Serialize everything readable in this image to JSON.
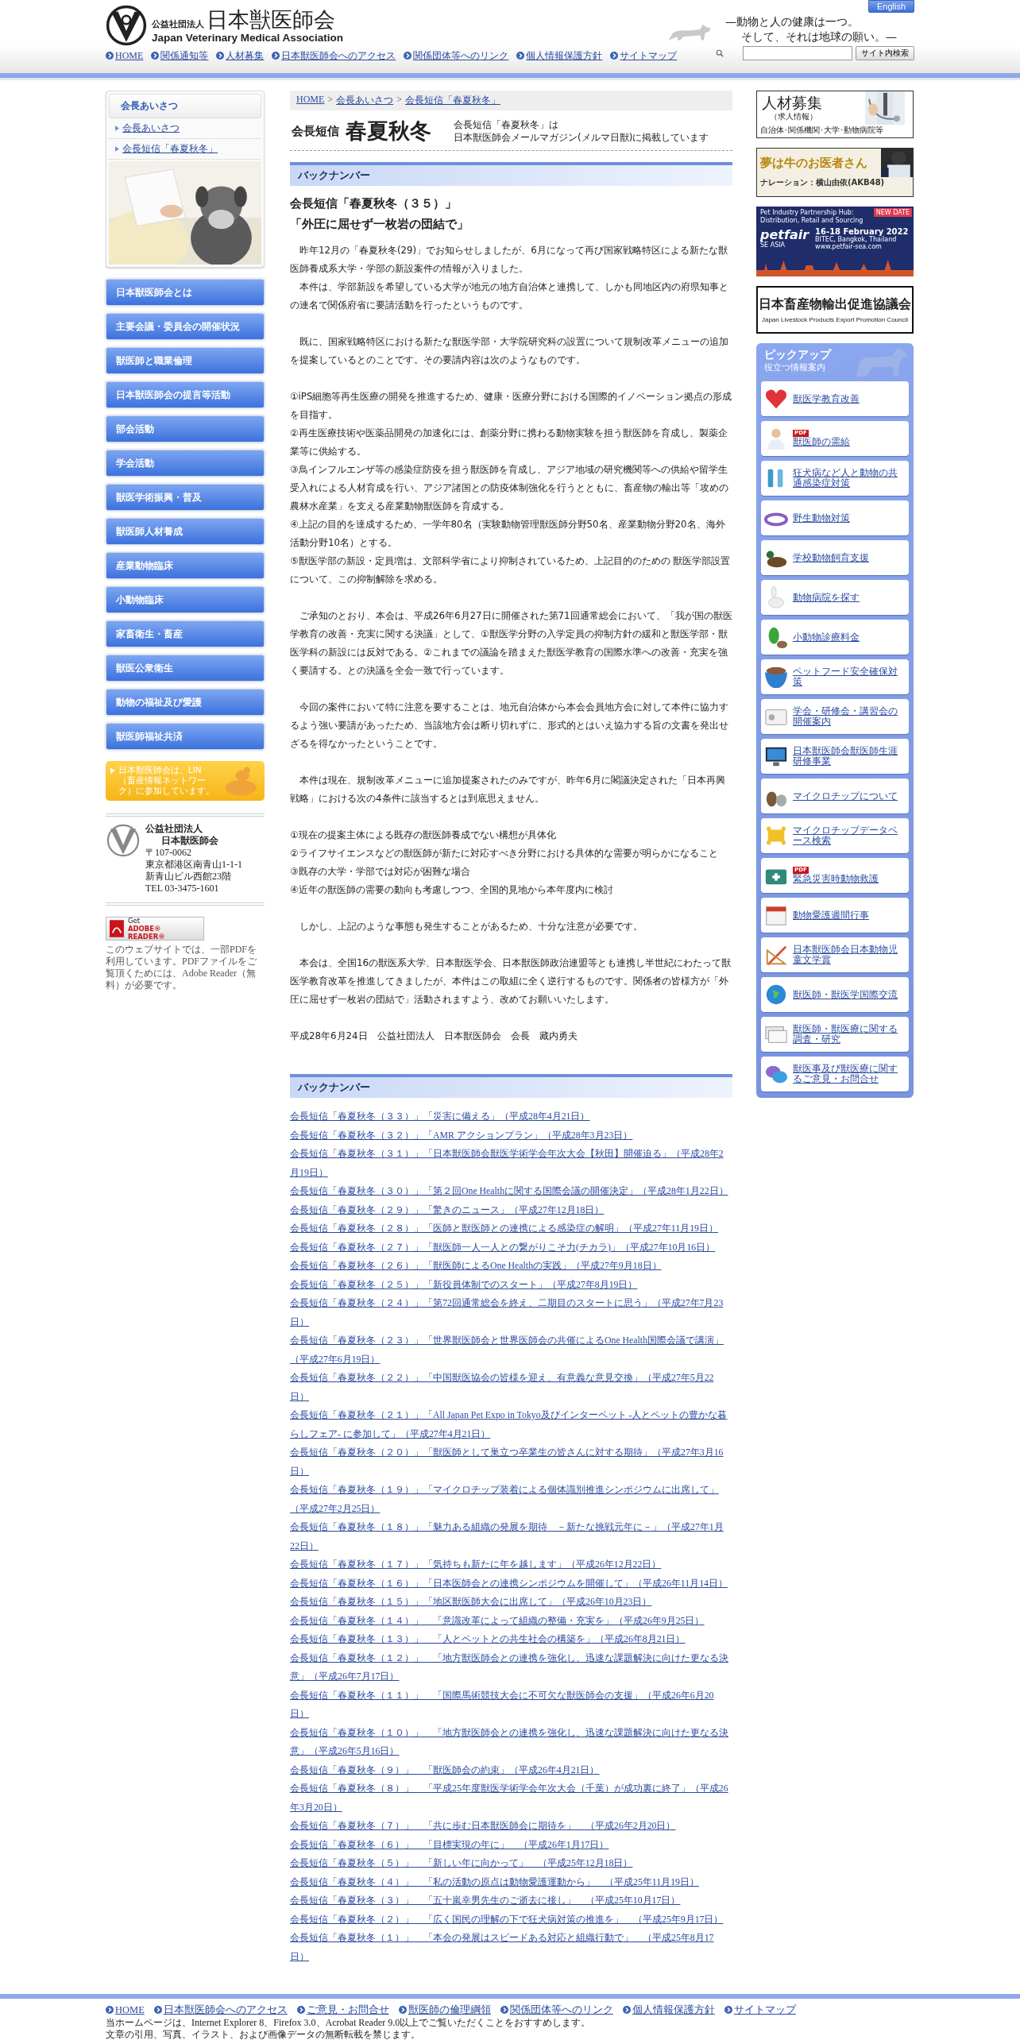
{
  "header": {
    "org_type": "公益社団法人",
    "org_name": "日本獣医師会",
    "org_name_en": "Japan Veterinary Medical Association",
    "english_button": "English",
    "tagline": [
      "—動物と人の健康は一つ。",
      "そして、それは地球の願い。—"
    ],
    "nav": [
      "HOME",
      "関係通知等",
      "人材募集",
      "日本獣医師会へのアクセス",
      "関係団体等へのリンク",
      "個人情報保護方針",
      "サイトマップ"
    ],
    "search_button": "サイト内検索"
  },
  "left": {
    "box_title": "会長あいさつ",
    "box_links": [
      "会長あいさつ",
      "会長短信「春夏秋冬」"
    ],
    "menu": [
      "日本獣医師会とは",
      "主要会議・委員会の開催状況",
      "獣医師と職業倫理",
      "日本獣医師会の提言等活動",
      "部会活動",
      "学会活動",
      "獣医学術振興・普及",
      "獣医師人材養成",
      "産業動物臨床",
      "小動物臨床",
      "家畜衛生・畜産",
      "獣医公衆衛生",
      "動物の福祉及び愛護",
      "獣医師福祉共済"
    ],
    "lin_banner": "日本獣医師会は、LIN（畜産情報ネットワーク）に参加しています。",
    "address": {
      "org_type": "公益社団法人",
      "org_name": "日本獣医師会",
      "lines": [
        "〒107-0062",
        "東京都港区南青山1-1-1",
        "新青山ビル西館23階",
        "TEL 03-3475-1601"
      ]
    },
    "adobe": {
      "get": "Get",
      "product": "ADOBE® READER®"
    },
    "pdf_note": "このウェブサイトでは、一部PDFを利用しています。PDFファイルをご覧頂くためには、Adobe Reader（無料）が必要です。"
  },
  "breadcrumb": {
    "items": [
      "HOME",
      "会長あいさつ",
      "会長短信「春夏秋冬」"
    ],
    "separator": ">"
  },
  "title": {
    "small": "会長短信",
    "large": "春夏秋冬",
    "note": [
      "会長短信「春夏秋冬」は",
      "日本獣医師会メールマガジン(メルマ日獣)に掲載しています"
    ]
  },
  "section_heading": "バックナンバー",
  "article": {
    "title": [
      "会長短信「春夏秋冬（３５）」",
      "「外圧に屈せず一枚岩の団結で」"
    ],
    "blocks": [
      [
        "　昨年12月の「春夏秋冬(29)」でお知らせしましたが、6月になって再び国家戦略特区による新たな獣医師養成系大学・学部の新設案件の情報が入りました。",
        "　本件は、学部新設を希望している大学が地元の地方自治体と連携して、しかも同地区内の府県知事との連名で関係府省に要請活動を行ったというものです。"
      ],
      [
        "　既に、国家戦略特区における新たな獣医学部・大学院研究科の設置について規制改革メニューの追加を提案しているとのことです。その要請内容は次のようなものです。"
      ],
      [
        "①iPS細胞等再生医療の開発を推進するため、健康・医療分野における国際的イノベーション拠点の形成を目指す。",
        "②再生医療技術や医薬品開発の加速化には、創薬分野に携わる動物実験を担う獣医師を育成し、製薬企業等に供給する。",
        "③鳥インフルエンザ等の感染症防疫を担う獣医師を育成し、アジア地域の研究機関等への供給や留学生受入れによる人材育成を行い、アジア諸国との防疫体制強化を行うとともに、畜産物の輸出等「攻めの農林水産業」を支える産業動物獣医師を育成する。",
        "④上記の目的を達成するため、一学年80名（実験動物管理獣医師分野50名、産業動物分野20名、海外活動分野10名）とする。",
        "⑤獣医学部の新設・定員増は、文部科学省により抑制されているため、上記目的のための 獣医学部設置について、この抑制解除を求める。"
      ],
      [
        "　ご承知のとおり、本会は、平成26年6月27日に開催された第71回通常総会において、「我が国の獣医学教育の改善・充実に関する決議」として、①獣医学分野の入学定員の抑制方針の緩和と獣医学部・獣医学科の新設には反対である。②これまでの議論を踏まえた獣医学教育の国際水準への改善・充実を強く要請する。との決議を全会一致で行っています。"
      ],
      [
        "　今回の案件において特に注意を要することは、地元自治体から本会会員地方会に対して本件に協力するよう強い要請があったため、当該地方会は断り切れずに、形式的とはいえ協力する旨の文書を発出せざるを得なかったということです。"
      ],
      [
        "　本件は現在、規制改革メニューに追加提案されたのみですが、昨年6月に閣議決定された「日本再興戦略」における次の4条件に該当するとは到底思えません。"
      ],
      [
        "①現在の提案主体による既存の獣医師養成でない構想が具体化",
        "②ライフサイエンスなどの獣医師が新たに対応すべき分野における具体的な需要が明らかになること",
        "③既存の大学・学部では対応が困難な場合",
        "④近年の獣医師の需要の動向も考慮しつつ、全国的見地から本年度内に検討"
      ],
      [
        "　しかし、上記のような事態も発生することがあるため、十分な注意が必要です。"
      ],
      [
        "　本会は、全国16の獣医系大学、日本獣医学会、日本獣医師政治連盟等とも連携し半世紀にわたって獣医学教育改革を推進してきましたが、本件はこの取組に全く逆行するものです。関係者の皆様方が「外圧に屈せず一枚岩の団結で」活動されますよう、改めてお願いいたします。"
      ],
      [
        "平成28年6月24日　公益社団法人　日本獣医師会　会長　藏内勇夫"
      ]
    ]
  },
  "backnumbers": {
    "heading": "バックナンバー",
    "items": [
      "会長短信「春夏秋冬（３３）」「災害に備える」（平成28年4月21日）",
      "会長短信「春夏秋冬（３２）」「AMR アクションプラン」（平成28年3月23日）",
      "会長短信「春夏秋冬（３１）」「日本獣医師会獣医学術学会年次大会【秋田】開催迫る」（平成28年2月19日）",
      "会長短信「春夏秋冬（３０）」「第２回One Healthに関する国際会議の開催決定」（平成28年1月22日）",
      "会長短信「春夏秋冬（２９）」「驚きのニュース」（平成27年12月18日）",
      "会長短信「春夏秋冬（２８）」「医師と獣医師との連携による感染症の解明」（平成27年11月19日）",
      "会長短信「春夏秋冬（２７）」「獣医師一人一人との繋がりこそ力(チカラ)」（平成27年10月16日）",
      "会長短信「春夏秋冬（２６）」「獣医師によるOne Healthの実践」（平成27年9月18日）",
      "会長短信「春夏秋冬（２５）」「新役員体制でのスタート」（平成27年8月19日）",
      "会長短信「春夏秋冬（２４）」「第72回通常総会を終え、二期目のスタートに思う」（平成27年7月23日）",
      "会長短信「春夏秋冬（２３）」「世界獣医師会と世界医師会の共催によるOne Health国際会議で講演」（平成27年6月19日）",
      "会長短信「春夏秋冬（２２）」「中国獣医協会の皆様を迎え、有意義な意見交換」（平成27年5月22日）",
      "会長短信「春夏秋冬（２１）」「All Japan Pet Expo in Tokyo及びインターペット -人とペットの豊かな暮らしフェア- に参加して」（平成27年4月21日）",
      "会長短信「春夏秋冬（２０）」「獣医師として巣立つ卒業生の皆さんに対する期待」（平成27年3月16日）",
      "会長短信「春夏秋冬（１９）」「マイクロチップ装着による個体識別推進シンポジウムに出席して」（平成27年2月25日）",
      "会長短信「春夏秋冬（１８）」「魅力ある組織の発展を期待　－新たな挑戦元年に－」（平成27年1月22日）",
      "会長短信「春夏秋冬（１７）」「気持ちも新たに年を越します」（平成26年12月22日）",
      "会長短信「春夏秋冬（１６）」「日本医師会との連携シンポジウムを開催して」（平成26年11月14日）",
      "会長短信「春夏秋冬（１５）」「地区獣医師大会に出席して」（平成26年10月23日）",
      "会長短信「春夏秋冬（１４）」　「意識改革によって組織の整備・充実を」（平成26年9月25日）",
      "会長短信「春夏秋冬（１３）」　「人とペットとの共生社会の構築を」（平成26年8月21日）",
      "会長短信「春夏秋冬（１２）」　「地方獣医師会との連携を強化し、迅速な課題解決に向けた更なる決意」（平成26年7月17日）",
      "会長短信「春夏秋冬（１１）」　「国際馬術競技大会に不可欠な獣医師会の支援」（平成26年6月20日）",
      "会長短信「春夏秋冬（１０）」　「地方獣医師会との連携を強化し、迅速な課題解決に向けた更なる決意」（平成26年5月16日）",
      "会長短信「春夏秋冬（９）」　「獣医師会の約束」（平成26年4月21日）",
      "会長短信「春夏秋冬（８）」　「平成25年度獣医学術学会年次大会（千葉）が成功裏に終了」（平成26年3月20日）",
      "会長短信「春夏秋冬（７）」　「共に歩む日本獣医師会に期待を」　（平成26年2月20日）",
      "会長短信「春夏秋冬（６）」　「目標実現の年に」　（平成26年1月17日）",
      "会長短信「春夏秋冬（５）」　「新しい年に向かって」　（平成25年12月18日）",
      "会長短信「春夏秋冬（４）」　「私の活動の原点は動物愛護運動から」　（平成25年11月19日）",
      "会長短信「春夏秋冬（３）」　「五十嵐幸男先生のご逝去に接し」　（平成25年10月17日）",
      "会長短信「春夏秋冬（２）」　「広く国民の理解の下で狂犬病対策の推進を」　（平成25年9月17日）",
      "会長短信「春夏秋冬（１）」　「本会の発展はスピードある対応と組織行動で」　（平成25年8月17日）"
    ]
  },
  "right": {
    "banners": [
      {
        "kind": "recruit",
        "title": "人材募集",
        "subtitle": "（求人情報）",
        "caption": "自治体･関係機関･大学･動物病院等"
      },
      {
        "kind": "video",
        "title": "夢は牛のお医者さん",
        "caption": "ナレーション：横山由依(AKB48)"
      },
      {
        "kind": "event",
        "tagline": "Pet Industry Partnership Hub: Distribution, Retail and Sourcing",
        "brand": "petfair",
        "region": "SE ASIA",
        "dates": "16-18 February 2022",
        "venue": "BITEC, Bangkok, Thailand",
        "url": "www.petfair-sea.com",
        "badge": "NEW DATE"
      },
      {
        "kind": "council",
        "title": "日本畜産物輸出促進協議会",
        "subtitle": "Japan Livestock Products Export Promotion Council"
      }
    ],
    "pickup": {
      "title": "ピックアップ",
      "subtitle": "役立つ情報案内",
      "items": [
        {
          "label": "獣医学教育改善"
        },
        {
          "label": "獣医師の需給",
          "badge": "PDF"
        },
        {
          "label": "狂犬病など人と動物の共通感染症対策"
        },
        {
          "label": "野生動物対策"
        },
        {
          "label": "学校動物飼育支援"
        },
        {
          "label": "動物病院を探す"
        },
        {
          "label": "小動物診療料金"
        },
        {
          "label": "ペットフード安全確保対策"
        },
        {
          "label": "学会・研修会・講習会の開催案内"
        },
        {
          "label": "日本獣医師会獣医師生涯研修事業"
        },
        {
          "label": "マイクロチップについて"
        },
        {
          "label": "マイクロチップデータベース検索"
        },
        {
          "label": "緊急災害時動物救護",
          "badge": "PDF"
        },
        {
          "label": "動物愛護週間行事"
        },
        {
          "label": "日本獣医師会日本動物児童文学賞"
        },
        {
          "label": "獣医師・獣医学国際交流"
        },
        {
          "label": "獣医師・獣医療に関する調査・研究"
        },
        {
          "label": "獣医事及び獣医療に関するご意見・お問合せ"
        }
      ]
    }
  },
  "footer": {
    "links": [
      "HOME",
      "日本獣医師会へのアクセス",
      "ご意見・お問合せ",
      "獣医師の倫理綱領",
      "関係団体等へのリンク",
      "個人情報保護方針",
      "サイトマップ"
    ],
    "notes": [
      "当ホームページは、Internet Explorer 8、Firefox 3.0、Acrobat Reader 9.0以上でご覧いただくことをおすすめします。",
      "文章の引用、写真、イラスト、および画像データの無断転載を禁じます。"
    ]
  }
}
